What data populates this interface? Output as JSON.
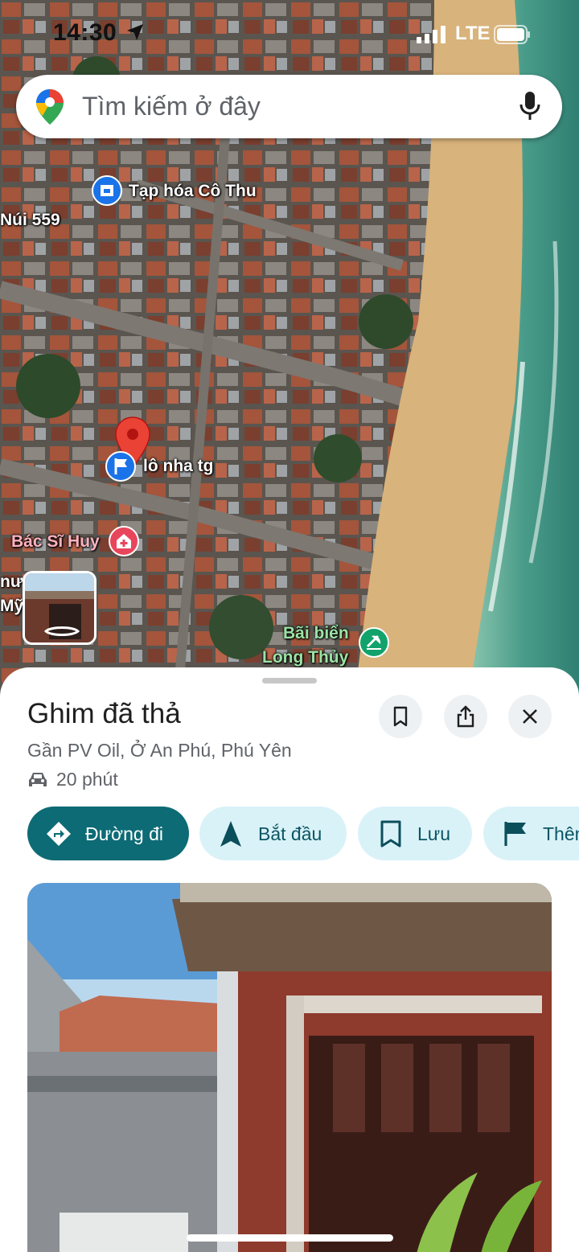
{
  "status_bar": {
    "time": "14:30",
    "network": "LTE"
  },
  "search": {
    "placeholder": "Tìm kiếm ở đây"
  },
  "map": {
    "labels": {
      "shop": "Tạp hóa Cô Thu",
      "mountain": "Núi 559",
      "pin": "lô nha tg",
      "doctor": "Bác Sĩ Huy",
      "beach_line1": "Bãi biển",
      "beach_line2": "Long Thủy",
      "edge_partial1": "nư",
      "edge_partial2": "Mỹ"
    }
  },
  "place": {
    "title": "Ghim đã thả",
    "address": "Gần PV Oil, Ở An Phú, Phú Yên",
    "drive_time": "20 phút"
  },
  "actions": {
    "directions": "Đường đi",
    "start": "Bắt đầu",
    "save": "Lưu",
    "more": "Thêm nhãn"
  },
  "colors": {
    "primary_action": "#0d6b75",
    "secondary_action_bg": "#d9f2f8",
    "pin_red": "#ea4335",
    "poi_blue": "#1a73e8"
  },
  "icons": [
    "location-arrow-icon",
    "google-maps-pin-icon",
    "mic-icon",
    "bookmark-icon",
    "share-icon",
    "close-icon",
    "car-icon",
    "directions-icon",
    "navigation-arrow-icon",
    "flag-icon"
  ]
}
